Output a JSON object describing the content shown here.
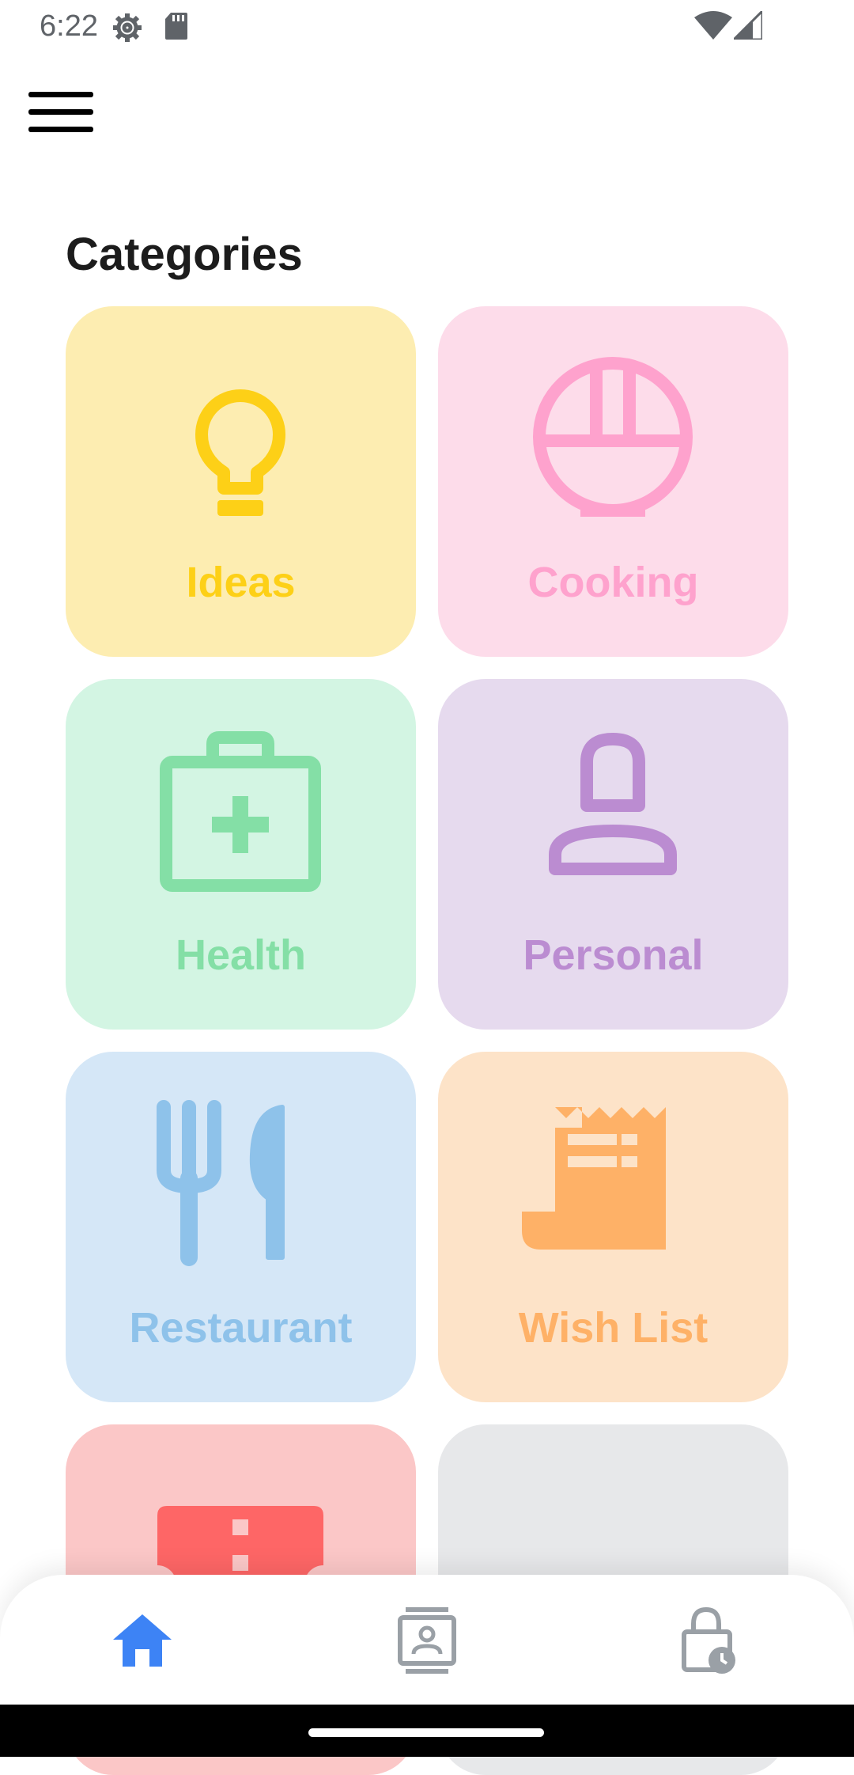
{
  "status_bar": {
    "time": "6:22",
    "icons": [
      "settings-icon",
      "sd-card-icon",
      "wifi-icon",
      "cellular-signal-icon"
    ]
  },
  "header": {
    "menu_icon": "hamburger-menu-icon"
  },
  "main": {
    "title": "Categories",
    "categories": [
      {
        "label": "Ideas",
        "icon": "lightbulb-icon",
        "background": "#FDEDB1",
        "color": "#FDD017"
      },
      {
        "label": "Cooking",
        "icon": "rice-bowl-icon",
        "background": "#FDDCEA",
        "color": "#FEA2CD"
      },
      {
        "label": "Health",
        "icon": "medical-kit-icon",
        "background": "#D3F5E3",
        "color": "#84DFA6"
      },
      {
        "label": "Personal",
        "icon": "person-icon",
        "background": "#E6DAEE",
        "color": "#BB8CD1"
      },
      {
        "label": "Restaurant",
        "icon": "fork-knife-icon",
        "background": "#D5E7F7",
        "color": "#8EC2EA"
      },
      {
        "label": "Wish List",
        "icon": "receipt-icon",
        "background": "#FDE3C8",
        "color": "#FEB167"
      },
      {
        "label": "",
        "icon": "ticket-icon",
        "background": "#FBC7C7",
        "color": "#FE6666"
      },
      {
        "label": "",
        "icon": "more-dots-icon",
        "background": "#E7E8EA",
        "color": "#A9AFB4"
      }
    ]
  },
  "bottom_nav": {
    "items": [
      {
        "icon": "home-icon",
        "active": true,
        "color": "#3D83F5"
      },
      {
        "icon": "contact-card-icon",
        "active": false,
        "color": "#9AA0A6"
      },
      {
        "icon": "lock-clock-icon",
        "active": false,
        "color": "#9AA0A6"
      }
    ]
  }
}
